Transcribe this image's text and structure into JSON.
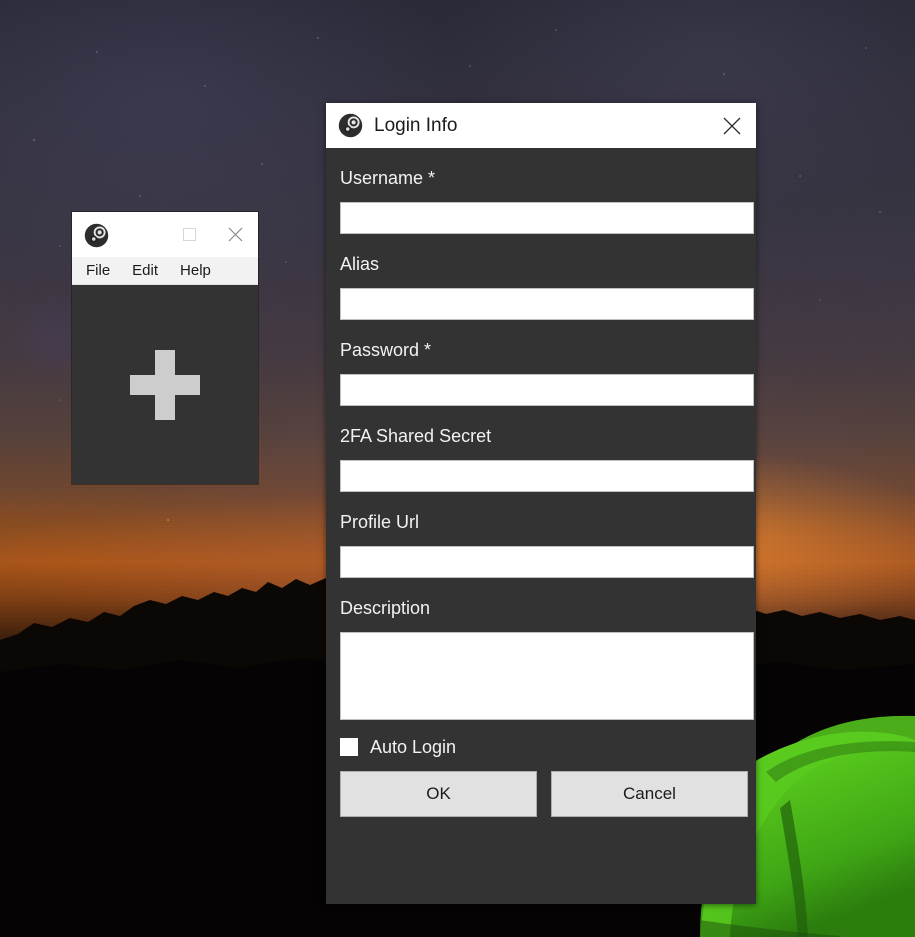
{
  "desktop": {
    "wallpaper_description": "night sky over mountain silhouette with orange sunset glow and green illuminated tent",
    "colors": {
      "sky_top": "#2a2a38",
      "sunset_orange": "#a8551a",
      "tent_green": "#4fc51a",
      "window_dark": "#333333",
      "titlebar_white": "#ffffff",
      "button_gray": "#e1e1e1"
    }
  },
  "accounts_window": {
    "icon": "steam-icon",
    "titlebar_buttons": {
      "minimize": "minimize-icon",
      "maximize": "maximize-icon",
      "close": "close-icon"
    },
    "menu": [
      {
        "label": "File"
      },
      {
        "label": "Edit"
      },
      {
        "label": "Help"
      }
    ],
    "body": {
      "add_icon": "plus-icon"
    }
  },
  "login_dialog": {
    "icon": "steam-icon",
    "title": "Login Info",
    "close_icon": "close-icon",
    "fields": [
      {
        "label": "Username *",
        "value": "",
        "placeholder": "",
        "type": "text",
        "name": "username"
      },
      {
        "label": "Alias",
        "value": "",
        "placeholder": "",
        "type": "text",
        "name": "alias"
      },
      {
        "label": "Password *",
        "value": "",
        "placeholder": "",
        "type": "text",
        "name": "password"
      },
      {
        "label": "2FA Shared Secret",
        "value": "",
        "placeholder": "",
        "type": "text",
        "name": "2fa-shared-secret"
      },
      {
        "label": "Profile Url",
        "value": "",
        "placeholder": "",
        "type": "text",
        "name": "profile-url"
      },
      {
        "label": "Description",
        "value": "",
        "placeholder": "",
        "type": "textarea",
        "name": "description"
      }
    ],
    "auto_login": {
      "label": "Auto Login",
      "checked": false
    },
    "buttons": {
      "ok": "OK",
      "cancel": "Cancel"
    }
  }
}
